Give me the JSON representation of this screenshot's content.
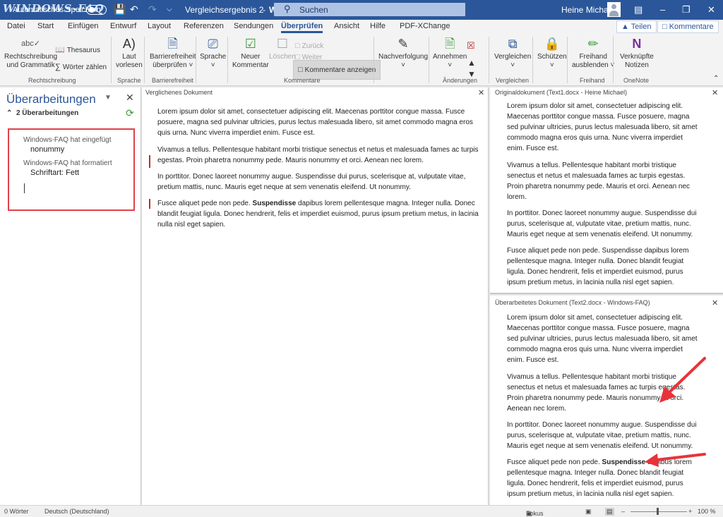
{
  "titlebar": {
    "logo": "WINDOWS-FAQ",
    "autosave": "Automatisches Speichern",
    "doc_title": "Vergleichsergebnis 2",
    "app": "Word",
    "search": "Suchen",
    "user": "Heine Michael"
  },
  "tabs": [
    "Datei",
    "Start",
    "Einfügen",
    "Entwurf",
    "Layout",
    "Referenzen",
    "Sendungen",
    "Überprüfen",
    "Ansicht",
    "Hilfe",
    "PDF-XChange"
  ],
  "share": {
    "share_label": "Teilen",
    "comments_label": "Kommentare"
  },
  "ribbon": {
    "proofing": {
      "spell": [
        "Rechtschreibung",
        "und Grammatik"
      ],
      "thesaurus": "Thesaurus",
      "wordcount": "Wörter zählen",
      "group": "Rechtschreibung"
    },
    "speech": {
      "read": [
        "Laut",
        "vorlesen"
      ],
      "group": "Sprache"
    },
    "access": {
      "check": [
        "Barrierefreiheit",
        "überprüfen ˅"
      ],
      "group": "Barrierefreiheit"
    },
    "lang": {
      "label": "Sprache",
      "group": ""
    },
    "comments": {
      "new": [
        "Neuer",
        "Kommentar"
      ],
      "delete": "Löschen",
      "back": "Zurück",
      "next": "Weiter",
      "show": "Kommentare anzeigen",
      "group": "Kommentare"
    },
    "tracking": {
      "label": "Nachverfolgung",
      "group": ""
    },
    "changes": {
      "accept": "Annehmen",
      "group": "Änderungen"
    },
    "compare": {
      "label": "Vergleichen",
      "group": "Vergleichen"
    },
    "protect": {
      "label": "Schützen"
    },
    "ink": {
      "label": [
        "Freihand",
        "ausblenden ˅"
      ],
      "group": "Freihand"
    },
    "onenote": {
      "label": [
        "Verknüpfte",
        "Notizen"
      ],
      "group": "OneNote"
    }
  },
  "revisions": {
    "title": "Überarbeitungen",
    "count": "2 Überarbeitungen",
    "items": [
      {
        "author": "Windows-FAQ hat eingefügt",
        "detail": "nonummy"
      },
      {
        "author": "Windows-FAQ hat formatiert",
        "detail": "Schriftart: Fett"
      }
    ]
  },
  "compared": {
    "header": "Verglichenes Dokument",
    "p1": "Lorem ipsum dolor sit amet, consectetuer adipiscing elit. Maecenas porttitor congue massa. Fusce posuere, magna sed pulvinar ultricies, purus lectus malesuada libero, sit amet commodo magna eros quis urna. Nunc viverra imperdiet enim. Fusce est.",
    "p2": "Vivamus a tellus. Pellentesque habitant morbi tristique senectus et netus et malesuada fames ac turpis egestas. Proin pharetra nonummy pede. Mauris nonummy et orci. Aenean nec lorem.",
    "p3": "In porttitor. Donec laoreet nonummy augue. Suspendisse dui purus, scelerisque at, vulputate vitae, pretium mattis, nunc. Mauris eget neque at sem venenatis eleifend. Ut nonummy.",
    "p4a": "Fusce aliquet pede non pede. ",
    "p4b": "Suspendisse",
    "p4c": " dapibus lorem pellentesque magna. Integer nulla. Donec blandit feugiat ligula. Donec hendrerit, felis et imperdiet euismod, purus ipsum pretium metus, in lacinia nulla nisl eget sapien."
  },
  "original": {
    "header": "Originaldokument (Text1.docx - Heine Michael)",
    "p1": "Lorem ipsum dolor sit amet, consectetuer adipiscing elit. Maecenas porttitor congue massa. Fusce posuere, magna sed pulvinar ultricies, purus lectus malesuada libero, sit amet commodo magna eros quis urna. Nunc viverra imperdiet enim. Fusce est.",
    "p2": "Vivamus a tellus. Pellentesque habitant morbi tristique senectus et netus et malesuada fames ac turpis egestas. Proin pharetra nonummy pede. Mauris et orci. Aenean nec lorem.",
    "p3": "In porttitor. Donec laoreet nonummy augue. Suspendisse dui purus, scelerisque at, vulputate vitae, pretium mattis, nunc. Mauris eget neque at sem venenatis eleifend. Ut nonummy.",
    "p4": "Fusce aliquet pede non pede. Suspendisse dapibus lorem pellentesque magna. Integer nulla. Donec blandit feugiat ligula. Donec hendrerit, felis et imperdiet euismod, purus ipsum pretium metus, in lacinia nulla nisl eget sapien."
  },
  "revised": {
    "header": "Überarbeitetes Dokument (Text2.docx - Windows-FAQ)",
    "p1": "Lorem ipsum dolor sit amet, consectetuer adipiscing elit. Maecenas porttitor congue massa. Fusce posuere, magna sed pulvinar ultricies, purus lectus malesuada libero, sit amet commodo magna eros quis urna. Nunc viverra imperdiet enim. Fusce est.",
    "p2": "Vivamus a tellus. Pellentesque habitant morbi tristique senectus et netus et malesuada fames ac turpis egestas. Proin pharetra nonummy pede. Mauris nonummy et orci. Aenean nec lorem.",
    "p3": "In porttitor. Donec laoreet nonummy augue. Suspendisse dui purus, scelerisque at, vulputate vitae, pretium mattis, nunc. Mauris eget neque at sem venenatis eleifend. Ut nonummy.",
    "p4a": "Fusce aliquet pede non pede. ",
    "p4b": "Suspendisse",
    "p4c": " dapibus lorem pellentesque magna. Integer nulla. Donec blandit feugiat ligula. Donec hendrerit, felis et imperdiet euismod, purus ipsum pretium metus, in lacinia nulla nisl eget sapien."
  },
  "status": {
    "words": "0 Wörter",
    "lang": "Deutsch (Deutschland)",
    "focus": "Fokus",
    "zoom": "100 %"
  },
  "colors": {
    "accent": "#2b579a",
    "revision_bar": "#c22c2c",
    "highlight_box": "#e0414b",
    "arrow": "#e8333a"
  }
}
